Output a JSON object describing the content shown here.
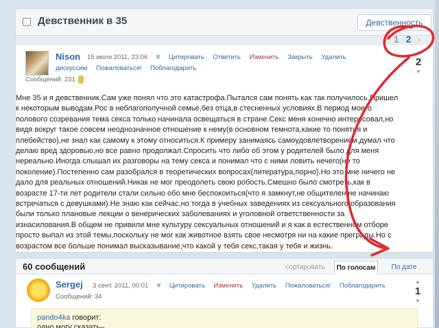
{
  "header": {
    "title": "Девственник в 35",
    "topic_button": "Девственность"
  },
  "pager": {
    "pages": [
      "1",
      "2"
    ],
    "prev": "‹",
    "next": "›"
  },
  "post": {
    "author": "Nison",
    "date": "15 июля 2011, 23:06",
    "hash": "#",
    "actions": [
      "Цитировать",
      "Ответить",
      "Изменить",
      "Закрыть",
      "Удалить"
    ],
    "actions2": [
      "дискуссию",
      "Пожаловаться!",
      "Поблагодарить"
    ],
    "messages": "Сообщений: 231",
    "vote_up": "▲",
    "vote_value": "2",
    "vote_down": "▼",
    "body_lines": [
      "Мне 35 и я девственник.Сам уже понял что это катастрофа.Пытался сам понять как так получилось.Пришел",
      "к некоторым выводам.Рос в неблагополучной семье,без отца,в стесненных условиях.В период моего",
      "полового созревания тема секса только начинала освещаться в стране.Секс меня конечно интересовал,но",
      "видя вокруг такое совсем неоднозначное отношение к нему(в основном темнота,какие то понятия и",
      "плебейство),не знал как самому к этому относиться.К примеру занимаясь самоудовлетворением,думал что",
      "делаю вред здоровью,но все равно продолжал.Спросить что либо об этом у родителей было для меня",
      "нереально.Иногда слышал их разговоры на тему секса и понимал что с ними ловить нечего(не то",
      "поколение).Постепенно сам разобрался в теоретических вопросах(литература,порно).Но это мне ничего не",
      "дало для реальных отношений.Никак не мог преодолеть свою робость.Смешно было смотреть,как в",
      "возрасте 17-ти лет родители стали сильно обо мне беспокоиться(что я замкнут,не общителен,не начинаю",
      "встречаться с девушками).Не знаю как сейчас,но тогда в учебных заведениях из сексуального образования",
      "были только плановые лекции о венерических заболеваниях и уголовной ответственности за",
      "изнасилования.В общем не привили мне культуру сексуальных отношений и я как в естественном отборе",
      "просто выпал из этой темы,поскольку не мог как животное взять свое несмотря ни на какие преграды.Но с",
      "возрастом все больше понимал высказывание,что какой у тебя секс,такая у тебя и жизнь."
    ]
  },
  "comments": {
    "count": "60 сообщений",
    "sort_options": [
      "сортировать",
      "По голосам",
      "По дате"
    ]
  },
  "comment": {
    "author": "Sergej",
    "date": "3 сент. 2011, 00:01",
    "hash": "#",
    "actions": [
      "Цитировать",
      "Изменить",
      "Удалить",
      "Пожаловаться!",
      "Поблагодарить"
    ],
    "messages": "Сообщений: 34",
    "vote_up": "▲",
    "vote_value": "1",
    "vote_down": "▼",
    "quote_author": "pando4ka",
    "quote_says": " говорит:",
    "quote_text": "одно могу сказать–"
  },
  "colors": {
    "link": "#2a6aa8",
    "annotation": "#e3262f",
    "quote_bg": "#fcf8de"
  }
}
